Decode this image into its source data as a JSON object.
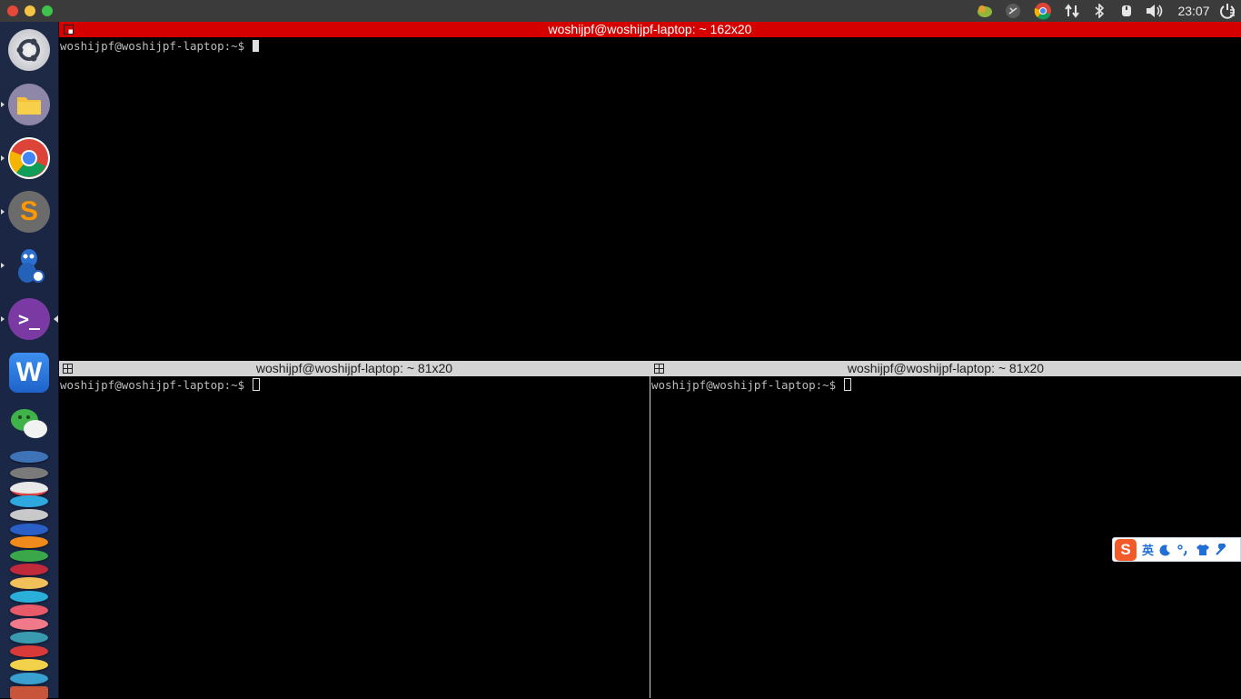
{
  "topbar": {
    "window_buttons": [
      "close",
      "minimize",
      "maximize"
    ],
    "tray_icons": [
      "cookie-app-icon",
      "indicator-icon",
      "chrome-icon",
      "network-icon",
      "bluetooth-icon",
      "keyboard-icon",
      "volume-icon"
    ],
    "clock": "23:07",
    "session_icon": "power-icon"
  },
  "launcher": {
    "apps": [
      {
        "name": "ubuntu-dash",
        "glyph": "◉"
      },
      {
        "name": "files",
        "glyph": "▬"
      },
      {
        "name": "chrome",
        "glyph": "●"
      },
      {
        "name": "sublime-text",
        "glyph": "S"
      },
      {
        "name": "app-mascot",
        "glyph": "☻"
      },
      {
        "name": "terminal",
        "glyph": ">_"
      },
      {
        "name": "wps-writer",
        "glyph": "W"
      },
      {
        "name": "wechat",
        "glyph": "✉"
      }
    ]
  },
  "terminals": {
    "top": {
      "title": "woshijpf@woshijpf-laptop: ~ 162x20",
      "prompt": "woshijpf@woshijpf-laptop:~$ ",
      "active": true
    },
    "bottom_left": {
      "title": "woshijpf@woshijpf-laptop: ~ 81x20",
      "prompt": "woshijpf@woshijpf-laptop:~$ ",
      "active": false
    },
    "bottom_right": {
      "title": "woshijpf@woshijpf-laptop: ~ 81x20",
      "prompt": "woshijpf@woshijpf-laptop:~$ ",
      "active": false
    }
  },
  "ime": {
    "logo": "S",
    "mode": "英",
    "icons": [
      "moon-icon",
      "punctuation-icon",
      "skin-icon",
      "settings-icon"
    ]
  },
  "colors": {
    "active_title": "#d40000",
    "inactive_title": "#d4d4d4"
  }
}
